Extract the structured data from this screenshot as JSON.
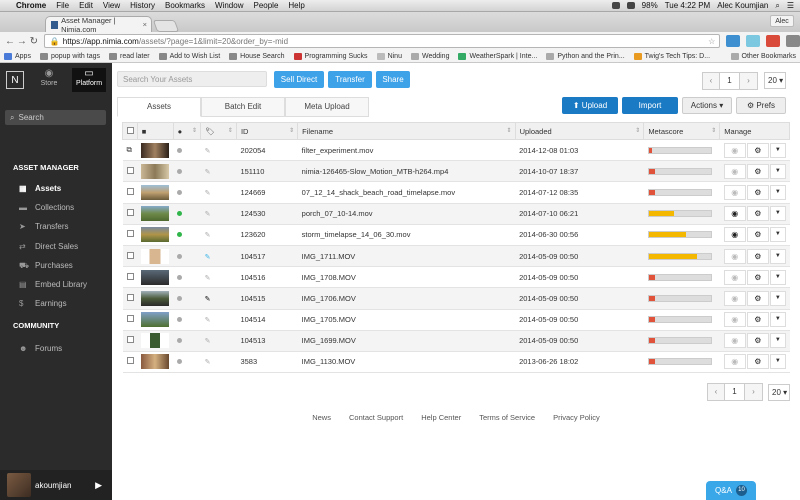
{
  "menubar": {
    "app": "Chrome",
    "items": [
      "File",
      "Edit",
      "View",
      "History",
      "Bookmarks",
      "Window",
      "People",
      "Help"
    ],
    "battery": "98%",
    "clock": "Tue 4:22 PM",
    "user": "Alec Koumjian"
  },
  "browser": {
    "tab_title": "Asset Manager | Nimia.com",
    "profile": "Alec",
    "url_host": "https://app.nimia.com",
    "url_path": "/assets/?page=1&limit=20&order_by=-mid",
    "bookmarks": [
      {
        "label": "Apps",
        "color": "#4a7bd8"
      },
      {
        "label": "popup with tags",
        "color": "#888"
      },
      {
        "label": "read later",
        "color": "#888"
      },
      {
        "label": "Add to Wish List",
        "color": "#888"
      },
      {
        "label": "House Search",
        "color": "#888"
      },
      {
        "label": "Programming Sucks",
        "color": "#c33"
      },
      {
        "label": "Ninu",
        "color": "#bbb"
      },
      {
        "label": "Wedding",
        "color": "#aaa"
      },
      {
        "label": "WeatherSpark | Inte...",
        "color": "#3a6"
      },
      {
        "label": "Python and the Prin...",
        "color": "#aaa"
      },
      {
        "label": "Twig's Tech Tips: D...",
        "color": "#e89b20"
      }
    ],
    "other_bookmarks": "Other Bookmarks"
  },
  "sidebar": {
    "logo": "N",
    "nav": [
      {
        "label": "Store",
        "glyph": "◉"
      },
      {
        "label": "Platform",
        "glyph": "▭"
      }
    ],
    "search_placeholder": "Search",
    "section1": "ASSET MANAGER",
    "items": [
      {
        "label": "Assets",
        "glyph": "▦"
      },
      {
        "label": "Collections",
        "glyph": "▬"
      },
      {
        "label": "Transfers",
        "glyph": "➤"
      },
      {
        "label": "Direct Sales",
        "glyph": "⇄"
      },
      {
        "label": "Purchases",
        "glyph": "⛟"
      },
      {
        "label": "Embed Library",
        "glyph": "▤"
      },
      {
        "label": "Earnings",
        "glyph": "$"
      }
    ],
    "section2": "COMMUNITY",
    "community": [
      {
        "label": "Forums",
        "glyph": "☻"
      }
    ],
    "username": "akoumjian"
  },
  "toolbar": {
    "search_placeholder": "Search Your Assets",
    "sell_direct": "Sell Direct",
    "transfer": "Transfer",
    "share": "Share",
    "upload": "⬆ Upload",
    "import": "Import",
    "actions": "Actions ▾",
    "prefs": "⚙ Prefs",
    "page": "1",
    "per_page": "20"
  },
  "subtabs": [
    "Assets",
    "Batch Edit",
    "Meta Upload"
  ],
  "columns": {
    "id": "ID",
    "filename": "Filename",
    "uploaded": "Uploaded",
    "metascore": "Metascore",
    "manage": "Manage"
  },
  "colors": {
    "red": "#e0533a",
    "yellow": "#f5b800",
    "green": "#2fb54a",
    "gray_dot": "#aaa"
  },
  "rows": [
    {
      "id": "202054",
      "filename": "filter_experiment.mov",
      "uploaded": "2014-12-08 01:03",
      "status": "gray",
      "tag": "gray",
      "score": 0.05,
      "scorecolor": "red",
      "thumb": "linear-gradient(90deg,#3a2a20,#a08060,#2b2017)",
      "multi": true,
      "eye": false
    },
    {
      "id": "151110",
      "filename": "nimia-126465-Slow_Motion_MTB-h264.mp4",
      "uploaded": "2014-10-07 18:37",
      "status": "gray",
      "tag": "gray",
      "score": 0.1,
      "scorecolor": "red",
      "thumb": "linear-gradient(90deg,#c9b796,#8c7a58,#d6c8a8)",
      "multi": false,
      "eye": false
    },
    {
      "id": "124669",
      "filename": "07_12_14_shack_beach_road_timelapse.mov",
      "uploaded": "2014-07-12 08:35",
      "status": "gray",
      "tag": "gray",
      "score": 0.1,
      "scorecolor": "red",
      "thumb": "linear-gradient(#9dbfd8,#c0a070,#6a5a3a)",
      "multi": false,
      "eye": false
    },
    {
      "id": "124530",
      "filename": "porch_07_10-14.mov",
      "uploaded": "2014-07-10 06:21",
      "status": "green",
      "tag": "gray",
      "score": 0.4,
      "scorecolor": "yellow",
      "thumb": "linear-gradient(#86aacb,#6e8a4a,#4f6a2e)",
      "multi": false,
      "eye": true
    },
    {
      "id": "123620",
      "filename": "storm_timelapse_14_06_30.mov",
      "uploaded": "2014-06-30 00:56",
      "status": "green",
      "tag": "gray",
      "score": 0.6,
      "scorecolor": "yellow",
      "thumb": "linear-gradient(#7a8aa0,#b09448,#5a6a30)",
      "multi": false,
      "eye": true
    },
    {
      "id": "104517",
      "filename": "IMG_1711.MOV",
      "uploaded": "2014-05-09 00:50",
      "status": "gray",
      "tag": "blue",
      "score": 0.78,
      "scorecolor": "yellow",
      "thumb": "linear-gradient(90deg,#fff 30%,#d8b690 30%,#d8b690 70%,#fff 70%)",
      "multi": false,
      "eye": false
    },
    {
      "id": "104516",
      "filename": "IMG_1708.MOV",
      "uploaded": "2014-05-09 00:50",
      "status": "gray",
      "tag": "gray",
      "score": 0.1,
      "scorecolor": "red",
      "thumb": "linear-gradient(#5a6a78,#2a2a2a)",
      "multi": false,
      "eye": false
    },
    {
      "id": "104515",
      "filename": "IMG_1706.MOV",
      "uploaded": "2014-05-09 00:50",
      "status": "gray",
      "tag": "black",
      "score": 0.1,
      "scorecolor": "red",
      "thumb": "linear-gradient(#a0b0b8,#4a5a3a,#2a2a2a)",
      "multi": false,
      "eye": false
    },
    {
      "id": "104514",
      "filename": "IMG_1705.MOV",
      "uploaded": "2014-05-09 00:50",
      "status": "gray",
      "tag": "gray",
      "score": 0.1,
      "scorecolor": "red",
      "thumb": "linear-gradient(#7fa0c8,#4f7030)",
      "multi": false,
      "eye": false
    },
    {
      "id": "104513",
      "filename": "IMG_1699.MOV",
      "uploaded": "2014-05-09 00:50",
      "status": "gray",
      "tag": "gray",
      "score": 0.1,
      "scorecolor": "red",
      "thumb": "linear-gradient(90deg,#fff 32%,#3a5a30 32%,#3a5a30 68%,#fff 68%)",
      "multi": false,
      "eye": false
    },
    {
      "id": "3583",
      "filename": "IMG_1130.MOV",
      "uploaded": "2013-06-26 18:02",
      "status": "gray",
      "tag": "gray",
      "score": 0.1,
      "scorecolor": "red",
      "thumb": "linear-gradient(90deg,#8a5a40,#d4b080,#6a4a30)",
      "multi": false,
      "eye": false
    }
  ],
  "footer": [
    "News",
    "Contact Support",
    "Help Center",
    "Terms of Service",
    "Privacy Policy"
  ],
  "qa": {
    "label": "Q&A",
    "count": "10"
  }
}
